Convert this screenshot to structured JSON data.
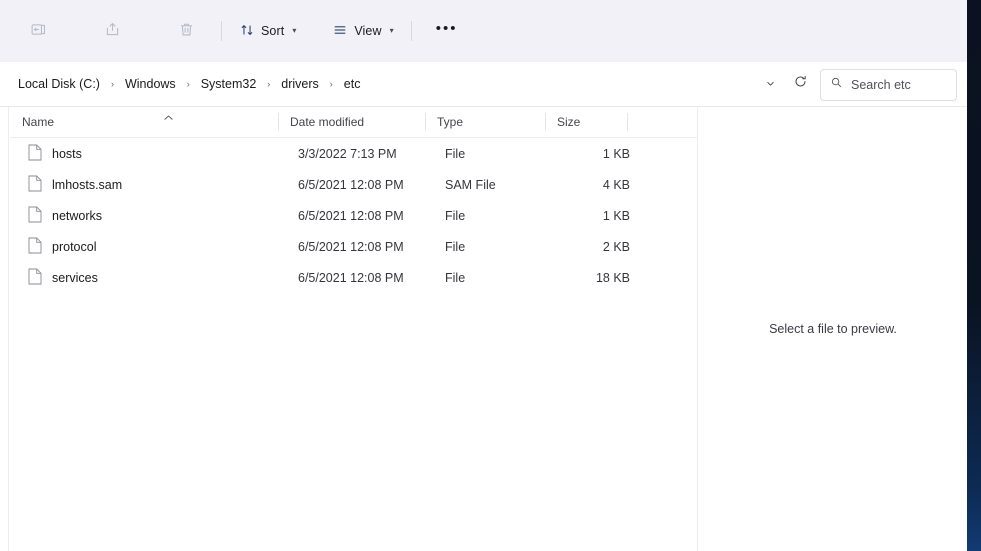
{
  "toolbar": {
    "buttons": [
      {
        "name": "rename",
        "icon": "rename-icon",
        "label": "",
        "disabled": true
      },
      {
        "name": "share",
        "icon": "share-icon",
        "label": "",
        "disabled": true
      },
      {
        "name": "delete",
        "icon": "trash-icon",
        "label": "",
        "disabled": true
      }
    ],
    "sort_label": "Sort",
    "view_label": "View",
    "more_label": "•••"
  },
  "address": {
    "breadcrumbs": [
      "Local Disk  (C:)",
      "Windows",
      "System32",
      "drivers",
      "etc"
    ],
    "separator": "›",
    "chevron": "˅",
    "refresh_icon": "refresh-icon"
  },
  "search": {
    "placeholder": "Search etc",
    "value": "",
    "icon": "search-icon"
  },
  "columns": {
    "name": "Name",
    "date_modified": "Date modified",
    "type": "Type",
    "size": "Size",
    "sort_indicator": "˄"
  },
  "files": [
    {
      "name": "hosts",
      "date": "3/3/2022 7:13 PM",
      "type": "File",
      "size": "1 KB",
      "icon": "file-icon"
    },
    {
      "name": "lmhosts.sam",
      "date": "6/5/2021 12:08 PM",
      "type": "SAM File",
      "size": "4 KB",
      "icon": "file-icon"
    },
    {
      "name": "networks",
      "date": "6/5/2021 12:08 PM",
      "type": "File",
      "size": "1 KB",
      "icon": "file-icon"
    },
    {
      "name": "protocol",
      "date": "6/5/2021 12:08 PM",
      "type": "File",
      "size": "2 KB",
      "icon": "file-icon"
    },
    {
      "name": "services",
      "date": "6/5/2021 12:08 PM",
      "type": "File",
      "size": "18 KB",
      "icon": "file-icon"
    }
  ],
  "preview": {
    "empty_message": "Select a file to preview."
  },
  "colors": {
    "toolbar_bg": "#f1f1f7",
    "pane_bg": "#ffffff",
    "text": "#1b1b1f",
    "muted_text": "#44444c",
    "divider": "#e4e4ea",
    "desktop_strip": "#0b1120"
  }
}
